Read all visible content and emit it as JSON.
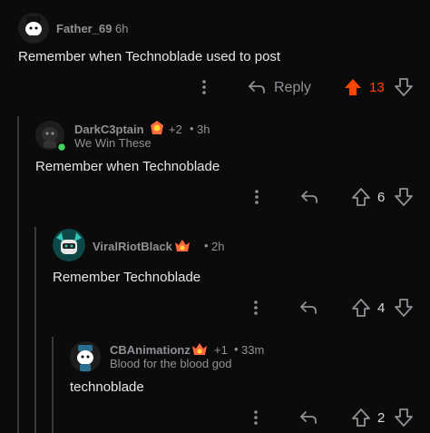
{
  "comments": [
    {
      "username": "Father_69",
      "time": "6h",
      "body": "Remember when Technoblade used to post",
      "reply_label": "Reply",
      "votes": "13",
      "upvoted": true
    },
    {
      "username": "DarkC3ptain",
      "award_count": "+2",
      "time": "3h",
      "flair": "We Win These",
      "body": "Remember when Technoblade",
      "votes": "6"
    },
    {
      "username": "ViralRiotBlack",
      "time": "2h",
      "body": "Remember Technoblade",
      "votes": "4"
    },
    {
      "username": "CBAnimationz",
      "award_count": "+1",
      "time": "33m",
      "flair": "Blood for the blood god",
      "body": "technoblade",
      "votes": "2"
    }
  ],
  "colors": {
    "background": "#0b0b0b",
    "upvote_active": "#ff4500",
    "muted": "#8e9296",
    "thread_line": "#3a3a3a"
  },
  "icons": [
    "more-vertical-icon",
    "reply-arrow-icon",
    "upvote-icon",
    "downvote-icon",
    "award-icon",
    "online-dot-icon"
  ]
}
